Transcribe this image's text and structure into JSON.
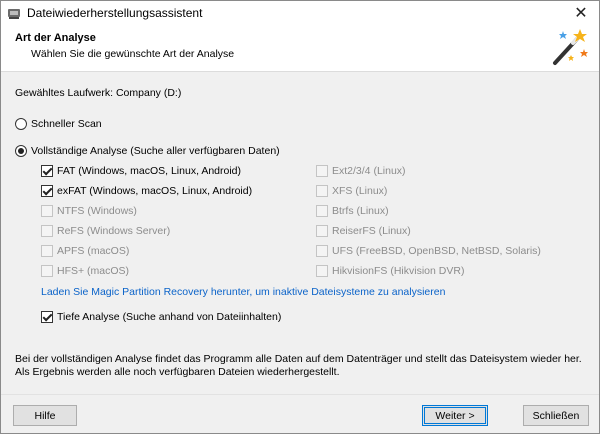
{
  "window": {
    "title": "Dateiwiederherstellungsassistent"
  },
  "header": {
    "title": "Art der Analyse",
    "subtitle": "Wählen Sie die gewünschte Art der Analyse"
  },
  "drive": {
    "label": "Gewähltes Laufwerk: Company (D:)"
  },
  "scan_options": {
    "quick_label": "Schneller Scan",
    "quick_checked": false,
    "full_label": "Vollständige Analyse (Suche aller verfügbaren Daten)",
    "full_checked": true
  },
  "filesystems": {
    "left": [
      {
        "label": "FAT (Windows, macOS, Linux, Android)",
        "checked": true,
        "enabled": true
      },
      {
        "label": "exFAT (Windows, macOS, Linux, Android)",
        "checked": true,
        "enabled": true
      },
      {
        "label": "NTFS (Windows)",
        "checked": false,
        "enabled": false
      },
      {
        "label": "ReFS (Windows Server)",
        "checked": false,
        "enabled": false
      },
      {
        "label": "APFS (macOS)",
        "checked": false,
        "enabled": false
      },
      {
        "label": "HFS+ (macOS)",
        "checked": false,
        "enabled": false
      }
    ],
    "right": [
      {
        "label": "Ext2/3/4 (Linux)",
        "checked": false,
        "enabled": false
      },
      {
        "label": "XFS (Linux)",
        "checked": false,
        "enabled": false
      },
      {
        "label": "Btrfs (Linux)",
        "checked": false,
        "enabled": false
      },
      {
        "label": "ReiserFS (Linux)",
        "checked": false,
        "enabled": false
      },
      {
        "label": "UFS (FreeBSD, OpenBSD, NetBSD, Solaris)",
        "checked": false,
        "enabled": false
      },
      {
        "label": "HikvisionFS (Hikvision DVR)",
        "checked": false,
        "enabled": false
      }
    ]
  },
  "download_link": "Laden Sie Magic Partition Recovery herunter, um inaktive Dateisysteme zu analysieren",
  "deep_analysis": {
    "label": "Tiefe Analyse (Suche anhand von Dateiinhalten)",
    "checked": true
  },
  "description": "Bei der vollständigen Analyse findet das Programm alle Daten auf dem Datenträger und stellt das Dateisystem wieder her. Als Ergebnis werden alle noch verfügbaren Dateien wiederhergestellt.",
  "buttons": {
    "help": "Hilfe",
    "next": "Weiter >",
    "close": "Schließen"
  },
  "icons": {
    "app": "app-icon",
    "close": "close-icon",
    "wizard": "magic-wand-icon"
  }
}
